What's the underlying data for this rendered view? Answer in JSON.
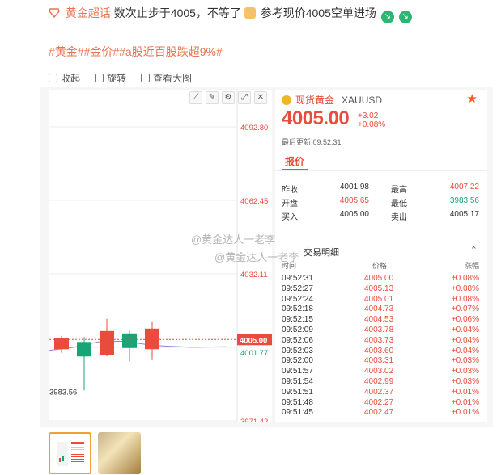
{
  "post": {
    "topic": "黄金超话",
    "text_a": "数次止步于4005，不等了",
    "text_b": "参考现价4005空单进场",
    "hashtags": "#黄金##金价##a股近百股跌超9%#"
  },
  "toolbar": {
    "collapse": "收起",
    "rotate": "旋转",
    "view_large": "查看大图"
  },
  "chart": {
    "axis_labels": [
      "4092.80",
      "4062.45",
      "4032.11",
      "4001.77",
      "3971.42"
    ],
    "current_price_label": "4005.00",
    "low_label": "3983.56",
    "tool_icons": [
      "line-tool-icon",
      "pen-tool-icon",
      "settings-tool-icon",
      "expand-icon",
      "close-icon"
    ]
  },
  "chart_data": {
    "type": "candlestick",
    "ylim": [
      3971.42,
      4092.8
    ],
    "y_ticks": [
      4092.8,
      4062.45,
      4032.11,
      4001.77,
      3971.42
    ],
    "candles": [
      {
        "open": 4005.5,
        "close": 4001.0,
        "high": 4006.5,
        "low": 3999.5,
        "direction": "down"
      },
      {
        "open": 3998.0,
        "close": 4004.0,
        "high": 4006.0,
        "low": 3984.0,
        "direction": "up"
      },
      {
        "open": 4008.5,
        "close": 3998.5,
        "high": 4013.5,
        "low": 3998.0,
        "direction": "down"
      },
      {
        "open": 4001.5,
        "close": 4007.5,
        "high": 4008.5,
        "low": 3996.0,
        "direction": "up"
      },
      {
        "open": 4009.5,
        "close": 4001.0,
        "high": 4012.5,
        "low": 3996.5,
        "direction": "down"
      }
    ],
    "current_price": 4005.0,
    "reference_price": 4001.77,
    "session_low": 3983.56
  },
  "quote": {
    "name": "现货黄金",
    "code": "XAUUSD",
    "price": "4005.00",
    "change": "+3.02",
    "change_pct": "+0.08%",
    "updated": "最后更新:09:52:31",
    "tab": "报价",
    "stats": [
      {
        "l1": "昨收",
        "v1": "4001.98",
        "c1": "dark",
        "l2": "最高",
        "v2": "4007.22",
        "c2": "red"
      },
      {
        "l1": "开盘",
        "v1": "4005.65",
        "c1": "red",
        "l2": "最低",
        "v2": "3983.56",
        "c2": "green"
      },
      {
        "l1": "买入",
        "v1": "4005.00",
        "c1": "dark",
        "l2": "卖出",
        "v2": "4005.17",
        "c2": "dark"
      }
    ],
    "trades_title": "交易明细",
    "trade_headers": {
      "time": "时间",
      "price": "价格",
      "change": "涨幅"
    },
    "trades": [
      {
        "time": "09:52:31",
        "price": "4005.00",
        "change": "+0.08%"
      },
      {
        "time": "09:52:27",
        "price": "4005.13",
        "change": "+0.08%"
      },
      {
        "time": "09:52:24",
        "price": "4005.01",
        "change": "+0.08%"
      },
      {
        "time": "09:52:18",
        "price": "4004.73",
        "change": "+0.07%"
      },
      {
        "time": "09:52:15",
        "price": "4004.53",
        "change": "+0.06%"
      },
      {
        "time": "09:52:09",
        "price": "4003.78",
        "change": "+0.04%"
      },
      {
        "time": "09:52:06",
        "price": "4003.73",
        "change": "+0.04%"
      },
      {
        "time": "09:52:03",
        "price": "4003.60",
        "change": "+0.04%"
      },
      {
        "time": "09:52:00",
        "price": "4003.31",
        "change": "+0.03%"
      },
      {
        "time": "09:51:57",
        "price": "4003.02",
        "change": "+0.03%"
      },
      {
        "time": "09:51:54",
        "price": "4002.99",
        "change": "+0.03%"
      },
      {
        "time": "09:51:51",
        "price": "4002.37",
        "change": "+0.01%"
      },
      {
        "time": "09:51:48",
        "price": "4002.27",
        "change": "+0.01%"
      },
      {
        "time": "09:51:45",
        "price": "4002.47",
        "change": "+0.01%"
      }
    ]
  },
  "watermarks": [
    "@黄金达人一老李",
    "@黄金达人一老李"
  ],
  "colors": {
    "up": "#17a578",
    "down": "#e74c3c",
    "accent": "#eb7350"
  }
}
